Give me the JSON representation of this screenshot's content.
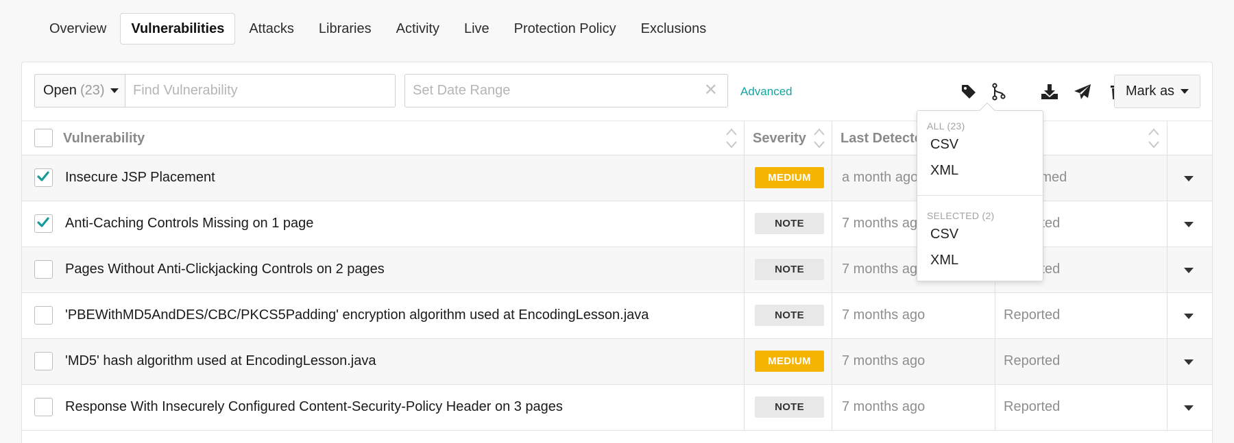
{
  "tabs": [
    {
      "label": "Overview"
    },
    {
      "label": "Vulnerabilities",
      "active": true
    },
    {
      "label": "Attacks"
    },
    {
      "label": "Libraries"
    },
    {
      "label": "Activity"
    },
    {
      "label": "Live"
    },
    {
      "label": "Protection Policy"
    },
    {
      "label": "Exclusions"
    }
  ],
  "toolbar": {
    "status_value": "Open",
    "status_count": "(23)",
    "search_placeholder": "Find Vulnerability",
    "date_placeholder": "Set Date Range",
    "advanced_label": "Advanced",
    "icons": [
      "tag-icon",
      "merge-icon",
      "download-icon",
      "send-icon",
      "trash-icon"
    ],
    "mark_as_label": "Mark as"
  },
  "table": {
    "headers": {
      "vulnerability": "Vulnerability",
      "severity": "Severity",
      "last_detected": "Last Detected"
    },
    "rows": [
      {
        "title": "Insecure JSP Placement",
        "severity": "MEDIUM",
        "last_detected": "a month ago",
        "status": "Confirmed",
        "checked": true
      },
      {
        "title": "Anti-Caching Controls Missing on 1 page",
        "severity": "NOTE",
        "last_detected": "7 months ago",
        "status": "Reported",
        "checked": true
      },
      {
        "title": "Pages Without Anti-Clickjacking Controls on 2 pages",
        "severity": "NOTE",
        "last_detected": "7 months ago",
        "status": "Reported",
        "checked": false
      },
      {
        "title": "'PBEWithMD5AndDES/CBC/PKCS5Padding' encryption algorithm used at EncodingLesson.java",
        "severity": "NOTE",
        "last_detected": "7 months ago",
        "status": "Reported",
        "checked": false
      },
      {
        "title": "'MD5' hash algorithm used at EncodingLesson.java",
        "severity": "MEDIUM",
        "last_detected": "7 months ago",
        "status": "Reported",
        "checked": false
      },
      {
        "title": "Response With Insecurely Configured Content-Security-Policy Header on 3 pages",
        "severity": "NOTE",
        "last_detected": "7 months ago",
        "status": "Reported",
        "checked": false
      }
    ]
  },
  "export_dropdown": {
    "all_header": "ALL (23)",
    "all_items": [
      "CSV",
      "XML"
    ],
    "selected_header": "SELECTED (2)",
    "selected_items": [
      "CSV",
      "XML"
    ]
  },
  "colors": {
    "accent": "#15a59e",
    "medium": "#f5b400",
    "note": "#e8e8e8"
  }
}
